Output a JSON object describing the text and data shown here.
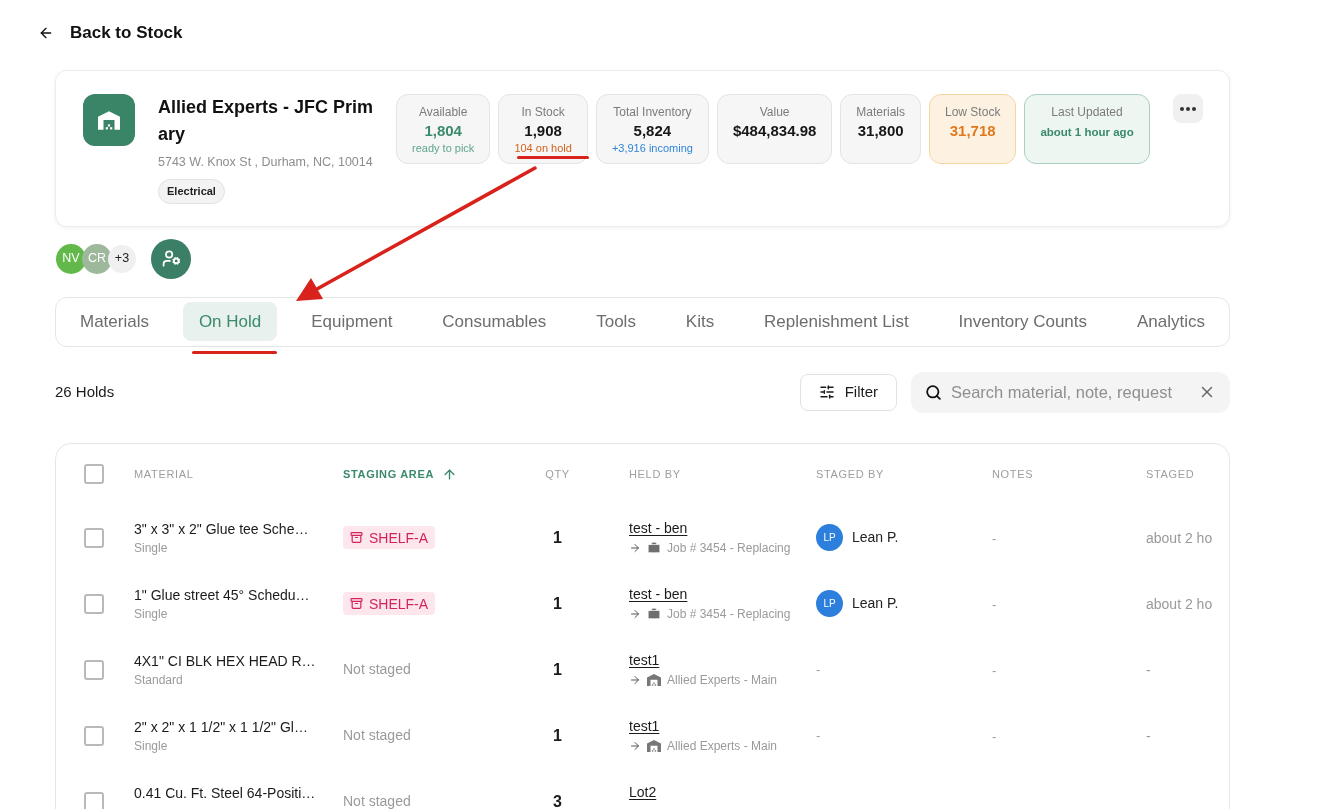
{
  "back_link": {
    "label": "Back to Stock"
  },
  "location": {
    "name": "Allied Experts - JFC Primary",
    "address": "5743 W. Knox St , Durham, NC, 10014",
    "tags": [
      "Electrical"
    ]
  },
  "stats": [
    {
      "label": "Available",
      "value": "1,804",
      "note": {
        "text": "ready to pick",
        "color": "#5fa58a"
      },
      "kind": "positive"
    },
    {
      "label": "In Stock",
      "value": "1,908",
      "note": {
        "text": "104 on hold",
        "color": "#d4621c"
      },
      "kind": "plain"
    },
    {
      "label": "Total Inventory",
      "value": "5,824",
      "note": {
        "text": "+3,916 incoming",
        "color": "#2d86d9"
      },
      "kind": "plain"
    },
    {
      "label": "Value",
      "value": "$484,834.98",
      "kind": "plain"
    },
    {
      "label": "Materials",
      "value": "31,800",
      "kind": "plain"
    },
    {
      "label": "Low Stock",
      "value": "31,718",
      "kind": "warning"
    },
    {
      "label": "Last Updated",
      "value": "about 1 hour ago",
      "kind": "status"
    }
  ],
  "team": {
    "members": [
      {
        "initials": "NV",
        "color": "#62b94a"
      },
      {
        "initials": "CR",
        "color": "#9db89b"
      }
    ],
    "more": "+3"
  },
  "tabs": [
    {
      "label": "Materials",
      "selected": false
    },
    {
      "label": "On Hold",
      "selected": true
    },
    {
      "label": "Equipment",
      "selected": false
    },
    {
      "label": "Consumables",
      "selected": false
    },
    {
      "label": "Tools",
      "selected": false
    },
    {
      "label": "Kits",
      "selected": false
    },
    {
      "label": "Replenishment List",
      "selected": false
    },
    {
      "label": "Inventory Counts",
      "selected": false
    },
    {
      "label": "Analytics",
      "selected": false
    }
  ],
  "holds": {
    "count": "26 Holds",
    "filter_label": "Filter",
    "search": {
      "placeholder": "Search material, note, request"
    }
  },
  "table": {
    "select_all": {
      "checked": false
    },
    "columns": [
      {
        "label": "MATERIAL",
        "sorted": false
      },
      {
        "label": "STAGING AREA",
        "sorted": true
      },
      {
        "label": "QTY",
        "sorted": false
      },
      {
        "label": "HELD BY",
        "sorted": false
      },
      {
        "label": "STAGED BY",
        "sorted": false
      },
      {
        "label": "NOTES",
        "sorted": false
      },
      {
        "label": "STAGED",
        "sorted": false
      }
    ],
    "rows": [
      {
        "checked": false,
        "material": "3\" x 3\" x 2\" Glue tee Sche…",
        "variant": "Single",
        "staging": {
          "kind": "shelf",
          "label": "SHELF-A"
        },
        "qty": "1",
        "held_by": {
          "name": "test - ben",
          "target": {
            "kind": "job",
            "label": "Job # 3454 - Replacing"
          }
        },
        "staged_by": {
          "kind": "user",
          "initials": "LP",
          "name": "Lean P."
        },
        "notes": "-",
        "staged": "about 2 ho"
      },
      {
        "checked": false,
        "material": "1\" Glue street 45° Schedu…",
        "variant": "Single",
        "staging": {
          "kind": "shelf",
          "label": "SHELF-A"
        },
        "qty": "1",
        "held_by": {
          "name": "test - ben",
          "target": {
            "kind": "job",
            "label": "Job # 3454 - Replacing"
          }
        },
        "staged_by": {
          "kind": "user",
          "initials": "LP",
          "name": "Lean P."
        },
        "notes": "-",
        "staged": "about 2 ho"
      },
      {
        "checked": false,
        "material": "4X1\" CI BLK HEX HEAD R…",
        "variant": "Standard",
        "staging": {
          "kind": "none",
          "label": "Not staged"
        },
        "qty": "1",
        "held_by": {
          "name": "test1",
          "target": {
            "kind": "location",
            "label": "Allied Experts - Main"
          }
        },
        "staged_by": {
          "kind": "none",
          "text": "-"
        },
        "notes": "-",
        "staged": "-"
      },
      {
        "checked": false,
        "material": "2\" x 2\" x 1 1/2\" x 1 1/2\" Gl…",
        "variant": "Single",
        "staging": {
          "kind": "none",
          "label": "Not staged"
        },
        "qty": "1",
        "held_by": {
          "name": "test1",
          "target": {
            "kind": "location",
            "label": "Allied Experts - Main"
          }
        },
        "staged_by": {
          "kind": "none",
          "text": "-"
        },
        "notes": "-",
        "staged": "-"
      },
      {
        "checked": false,
        "material": "0.41 Cu. Ft. Steel 64-Positi…",
        "staging": {
          "kind": "none",
          "label": "Not staged"
        },
        "qty": "3",
        "held_by": {
          "name": "Lot2"
        }
      }
    ]
  }
}
